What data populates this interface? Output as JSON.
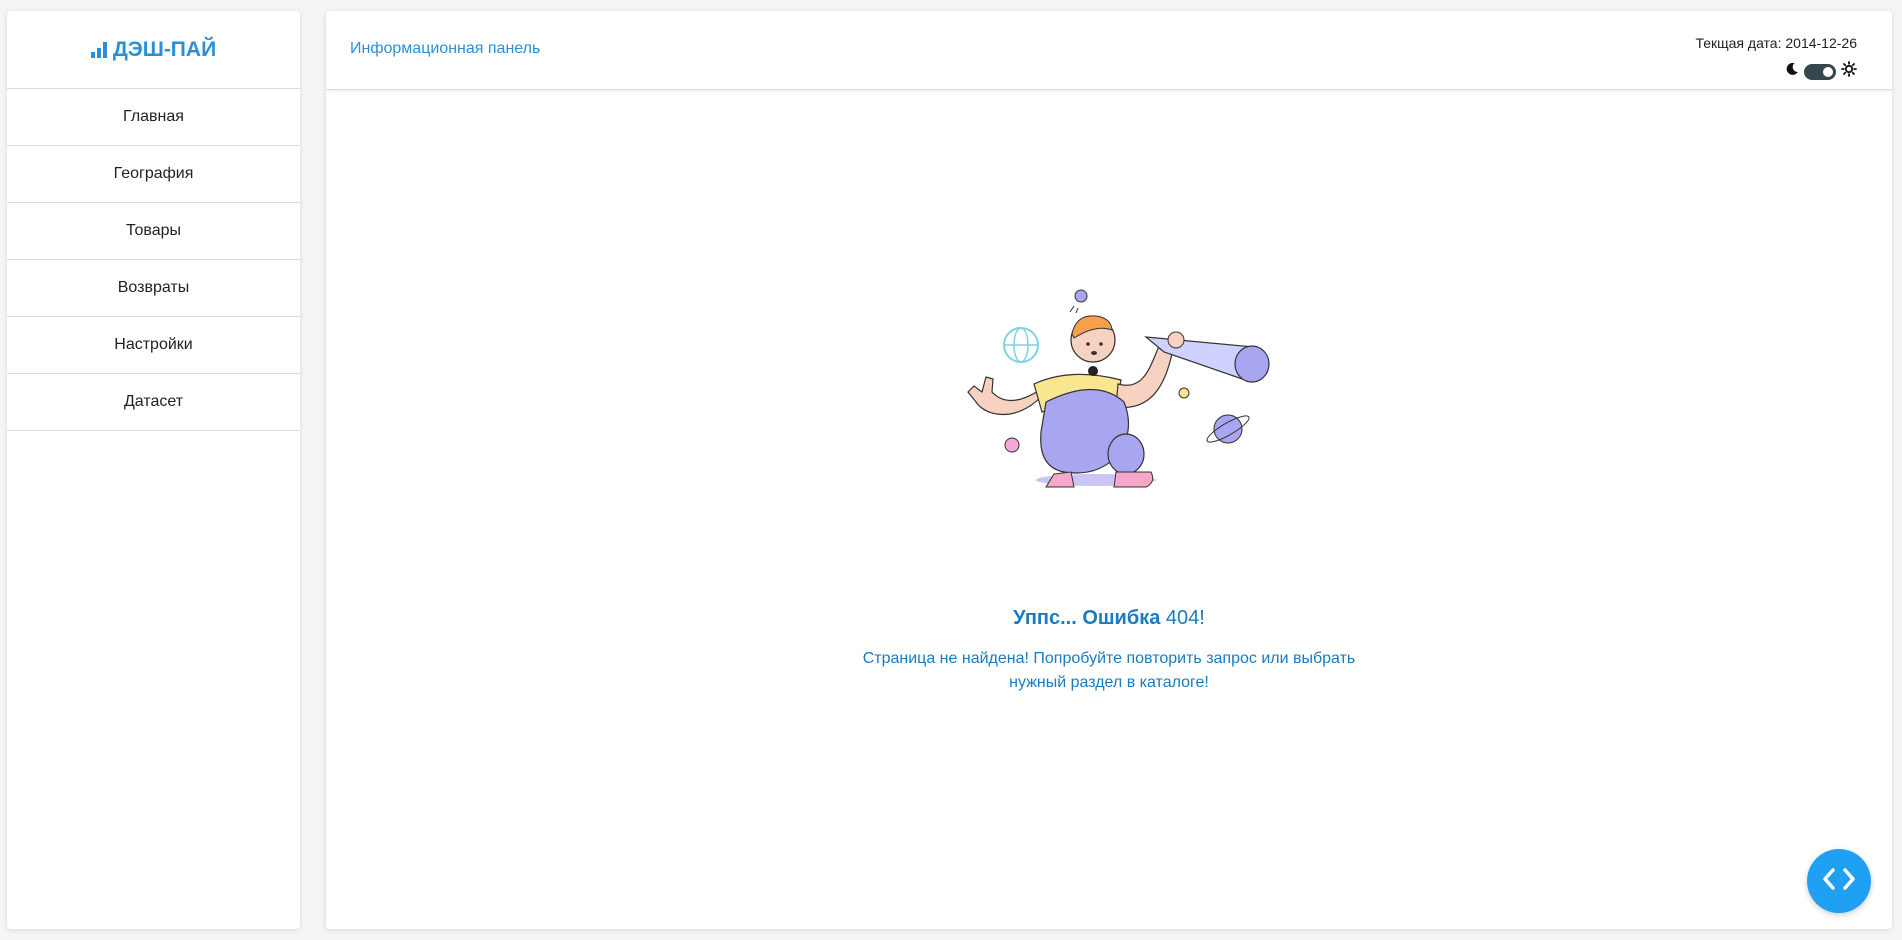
{
  "brand": {
    "name": "ДЭШ-ПАЙ",
    "icon": "bar-chart-icon"
  },
  "sidebar": {
    "items": [
      {
        "label": "Главная"
      },
      {
        "label": "География"
      },
      {
        "label": "Товары"
      },
      {
        "label": "Возвраты"
      },
      {
        "label": "Настройки"
      },
      {
        "label": "Датасет"
      }
    ]
  },
  "header": {
    "title": "Информационная панель",
    "date_label": "Текщая дата:",
    "date_value": "2014-12-26",
    "theme_icons": [
      "moon-icon",
      "sun-icon"
    ]
  },
  "error": {
    "title_text": "Уппс... Ошибка",
    "title_code": "404!",
    "line1": "Страница не найдена! Попробуйте повторить запрос или выбрать",
    "line2": "нужный раздел в каталоге!"
  },
  "colors": {
    "accent": "#2a8fd6",
    "error_text": "#1a7bbf",
    "fab": "#1fa0f3",
    "illustration_purple": "#a9a6f1"
  },
  "fab": {
    "icon": "code-icon"
  }
}
